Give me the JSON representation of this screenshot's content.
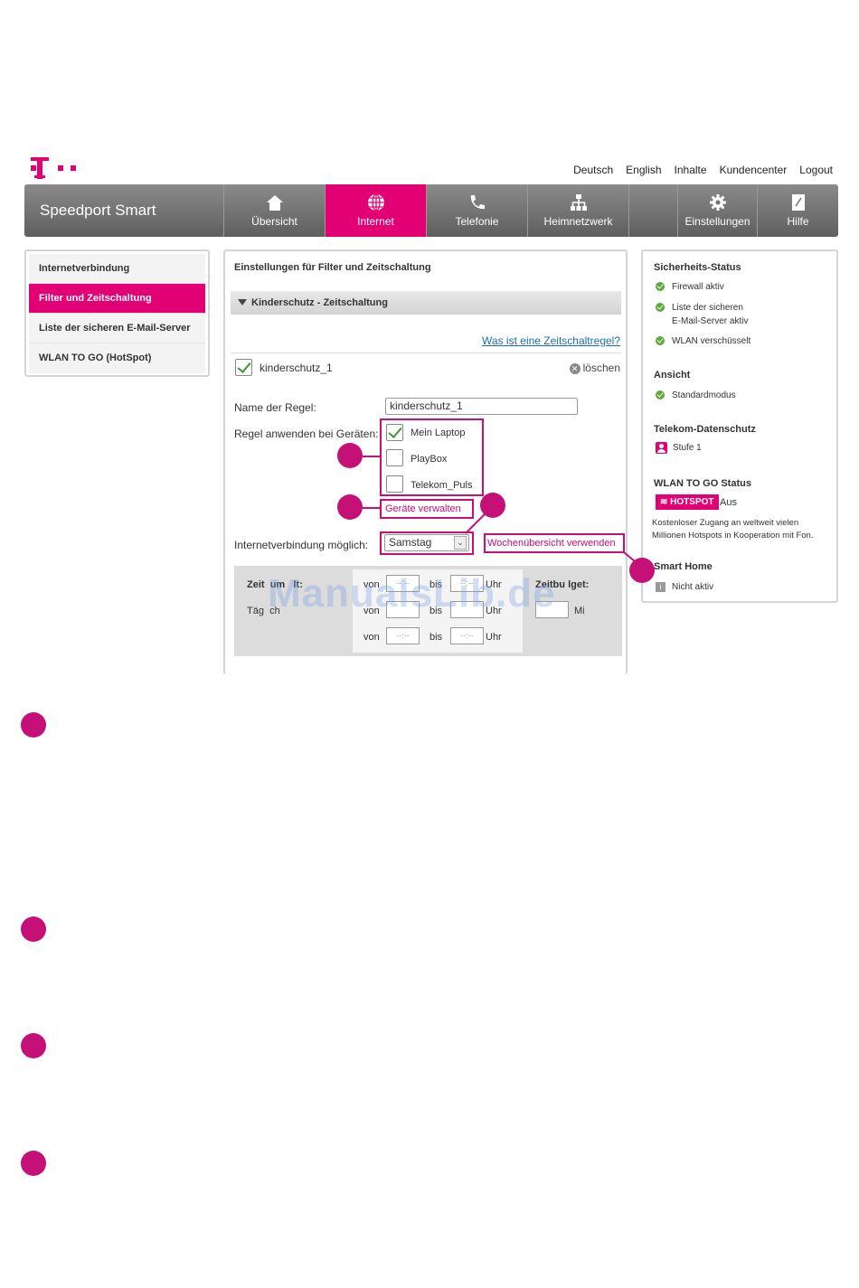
{
  "toplinks": [
    "Deutsch",
    "English",
    "Inhalte",
    "Kundencenter",
    "Logout"
  ],
  "nav": {
    "brand": "Speedport Smart",
    "items": [
      {
        "label": "Übersicht",
        "icon": "home-icon"
      },
      {
        "label": "Internet",
        "icon": "globe-icon",
        "active": true
      },
      {
        "label": "Telefonie",
        "icon": "phone-icon"
      },
      {
        "label": "Heimnetzwerk",
        "icon": "network-icon"
      },
      {
        "label": "Einstellungen",
        "icon": "gear-icon"
      },
      {
        "label": "Hilfe",
        "icon": "help-book-icon"
      }
    ]
  },
  "leftmenu": [
    {
      "label": "Internetverbindung"
    },
    {
      "label": "Filter und Zeitschaltung",
      "active": true
    },
    {
      "label": "Liste der sicheren E-Mail-Server"
    },
    {
      "label": "WLAN TO GO (HotSpot)"
    }
  ],
  "main": {
    "title": "Einstellungen für Filter und Zeitschaltung",
    "section": "Kinderschutz - Zeitschaltung",
    "help_link": "Was ist eine Zeitschaltregel?",
    "rule_name_toggle": "kinderschutz_1",
    "delete": "löschen",
    "name_label": "Name der Regel:",
    "name_value": "kinderschutz_1",
    "devices_label": "Regel anwenden bei Geräten:",
    "devices": [
      {
        "label": "Mein Laptop",
        "checked": true
      },
      {
        "label": "PlayBox",
        "checked": false
      },
      {
        "label": "Telekom_Puls",
        "checked": false
      }
    ],
    "manage_devices": "Geräte verwalten",
    "internet_label": "Internetverbindung möglich:",
    "day_select": "Samstag",
    "week_overview": "Wochenübersicht verwenden",
    "time_label_1": "Zeit",
    "time_label_1b": "um",
    "time_label_1c": "lt:",
    "daily_label_a": "Täg",
    "daily_label_b": "ch",
    "von": "von",
    "bis": "bis",
    "uhr": "Uhr",
    "time_placeholder": "--:--",
    "budget_label_a": "Zeitbu",
    "budget_label_b": "lget:",
    "budget_suffix": "Mi"
  },
  "right": {
    "security_title": "Sicherheits-Status",
    "security_items": [
      "Firewall aktiv",
      "Liste der sicheren",
      "E-Mail-Server aktiv",
      "WLAN verschüsselt"
    ],
    "view_title": "Ansicht",
    "view_item": "Standardmodus",
    "privacy_title": "Telekom-Datenschutz",
    "privacy_item": "Stufe 1",
    "wlan_title": "WLAN TO GO Status",
    "hotspot_badge": "HOTSPOT",
    "hotspot_state": "Aus",
    "hotspot_desc_1": "Kostenloser Zugang an weltweit vielen",
    "hotspot_desc_2": "Millionen Hotspots in Kooperation mit Fon.",
    "smarthome_title": "Smart Home",
    "smarthome_item": "Nicht aktiv"
  },
  "watermark": "ManualsLib.de",
  "colors": {
    "magenta": "#e20074",
    "callout": "#c51077",
    "ok": "#5ea93a",
    "link": "#1a6db8"
  }
}
